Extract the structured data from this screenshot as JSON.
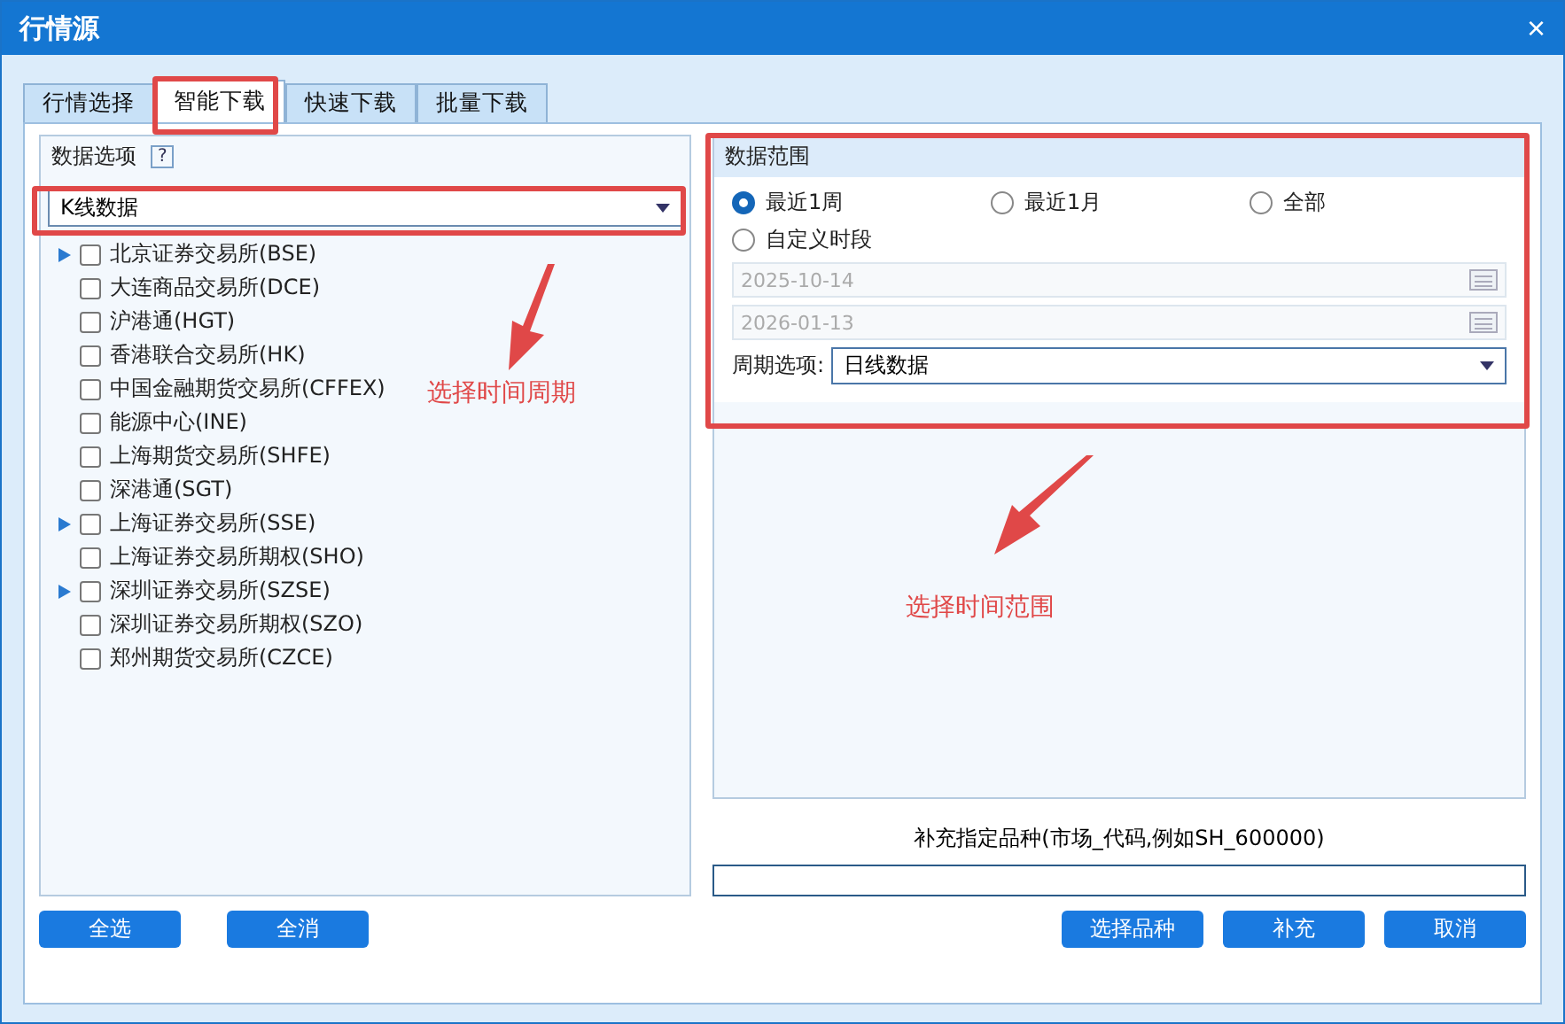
{
  "window": {
    "title": "行情源",
    "close": "×"
  },
  "tabs": [
    {
      "label": "行情选择",
      "selected": false
    },
    {
      "label": "智能下载",
      "selected": true
    },
    {
      "label": "快速下载",
      "selected": false
    },
    {
      "label": "批量下载",
      "selected": false
    }
  ],
  "left_panel": {
    "title": "数据选项",
    "help": "?",
    "data_type": "K线数据",
    "exchanges": [
      {
        "label": "北京证券交易所(BSE)",
        "expandable": true,
        "checked": false
      },
      {
        "label": "大连商品交易所(DCE)",
        "expandable": false,
        "checked": false
      },
      {
        "label": "沪港通(HGT)",
        "expandable": false,
        "checked": false
      },
      {
        "label": "香港联合交易所(HK)",
        "expandable": false,
        "checked": false
      },
      {
        "label": "中国金融期货交易所(CFFEX)",
        "expandable": false,
        "checked": false
      },
      {
        "label": "能源中心(INE)",
        "expandable": false,
        "checked": false
      },
      {
        "label": "上海期货交易所(SHFE)",
        "expandable": false,
        "checked": false
      },
      {
        "label": "深港通(SGT)",
        "expandable": false,
        "checked": false
      },
      {
        "label": "上海证券交易所(SSE)",
        "expandable": true,
        "checked": false
      },
      {
        "label": "上海证券交易所期权(SHO)",
        "expandable": false,
        "checked": false
      },
      {
        "label": "深圳证券交易所(SZSE)",
        "expandable": true,
        "checked": false
      },
      {
        "label": "深圳证券交易所期权(SZO)",
        "expandable": false,
        "checked": false
      },
      {
        "label": "郑州期货交易所(CZCE)",
        "expandable": false,
        "checked": false
      }
    ],
    "buttons": [
      "全选",
      "全消"
    ]
  },
  "right_panel": {
    "title": "数据范围",
    "ranges": [
      {
        "label": "最近1周",
        "selected": true
      },
      {
        "label": "最近1月",
        "selected": false
      },
      {
        "label": "全部",
        "selected": false
      },
      {
        "label": "自定义时段",
        "selected": false
      }
    ],
    "start_date": {
      "value": "2025-10-14",
      "disabled": true
    },
    "end_date": {
      "value": "2026-01-13",
      "disabled": true
    },
    "period_label": "周期选项:",
    "period": "日线数据"
  },
  "supplement": {
    "label": "补充指定品种(市场_代码,例如SH_600000)"
  },
  "buttons": [
    "选择品种",
    "补充",
    "取消"
  ],
  "annotations": [
    {
      "text": "选择时间周期"
    },
    {
      "text": "选择时间范围"
    }
  ]
}
